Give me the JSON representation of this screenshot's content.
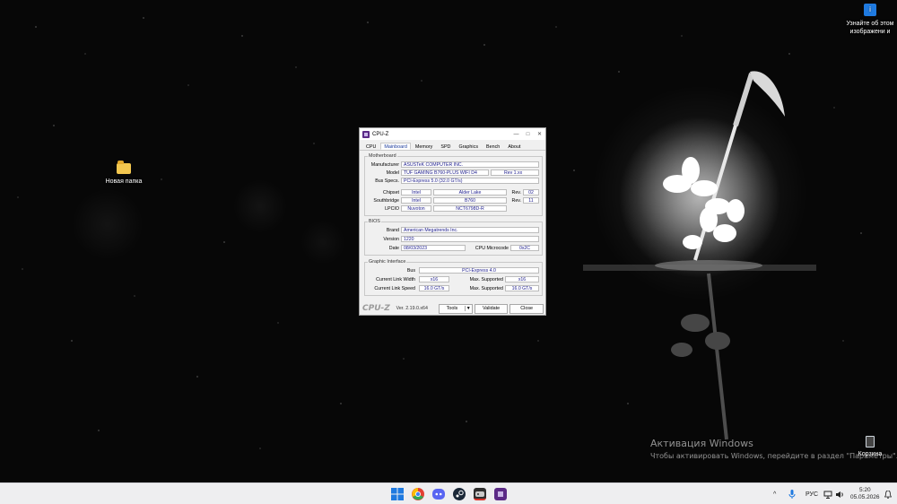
{
  "desktop": {
    "icon_folder_label": "Новая папка",
    "icon_info_label": "Узнайте об этом изображени и",
    "icon_recycle_label": "Корзина",
    "activation_title": "Активация Windows",
    "activation_text": "Чтобы активировать Windows, перейдите в раздел \"Параметры\"."
  },
  "window": {
    "title": "CPU-Z",
    "controls": {
      "minimize": "—",
      "maximize": "□",
      "close": "✕"
    },
    "tabs": [
      "CPU",
      "Mainboard",
      "Memory",
      "SPD",
      "Graphics",
      "Bench",
      "About"
    ],
    "active_tab": "Mainboard",
    "motherboard": {
      "group_title": "Motherboard",
      "manufacturer_label": "Manufacturer",
      "manufacturer": "ASUSTeK COMPUTER INC.",
      "model_label": "Model",
      "model": "TUF GAMING B760-PLUS WIFI D4",
      "model_rev": "Rev 1.xx",
      "bus_label": "Bus Specs.",
      "bus": "PCI-Express 5.0 (32.0 GT/s)",
      "chipset_label": "Chipset",
      "chipset_vendor": "Intel",
      "chipset_name": "Alder Lake",
      "chipset_rev_label": "Rev.",
      "chipset_rev": "02",
      "southbridge_label": "Southbridge",
      "southbridge_vendor": "Intel",
      "southbridge_name": "B760",
      "southbridge_rev_label": "Rev.",
      "southbridge_rev": "11",
      "lpcio_label": "LPCIO",
      "lpcio_vendor": "Nuvoton",
      "lpcio_name": "NCT6798D-R"
    },
    "bios": {
      "group_title": "BIOS",
      "brand_label": "Brand",
      "brand": "American Megatrends Inc.",
      "version_label": "Version",
      "version": "1220",
      "date_label": "Date",
      "date": "08/03/2023",
      "microcode_label": "CPU Microcode",
      "microcode": "0x2C"
    },
    "graphic": {
      "group_title": "Graphic Interface",
      "bus_label": "Bus",
      "bus": "PCI-Express 4.0",
      "link_width_label": "Current Link Width",
      "link_width": "x16",
      "max_width_label": "Max. Supported",
      "max_width": "x16",
      "link_speed_label": "Current Link Speed",
      "link_speed": "16.0 GT/s",
      "max_speed_label": "Max. Supported",
      "max_speed": "16.0 GT/s"
    },
    "footer": {
      "logo": "CPU-Z",
      "version": "Ver. 2.19.0.x64",
      "tools_label": "Tools",
      "validate_label": "Validate",
      "close_label": "Close"
    }
  },
  "taskbar": {
    "tray_chevron": "^",
    "language": "РУС",
    "time": "5:20",
    "date": "05.05.2026",
    "colors": {
      "start": "#1f7ae0",
      "chrome_red": "#e34133",
      "discord": "#5865f2",
      "steam": "#1b2838",
      "cpuz": "#5b2a86"
    }
  }
}
